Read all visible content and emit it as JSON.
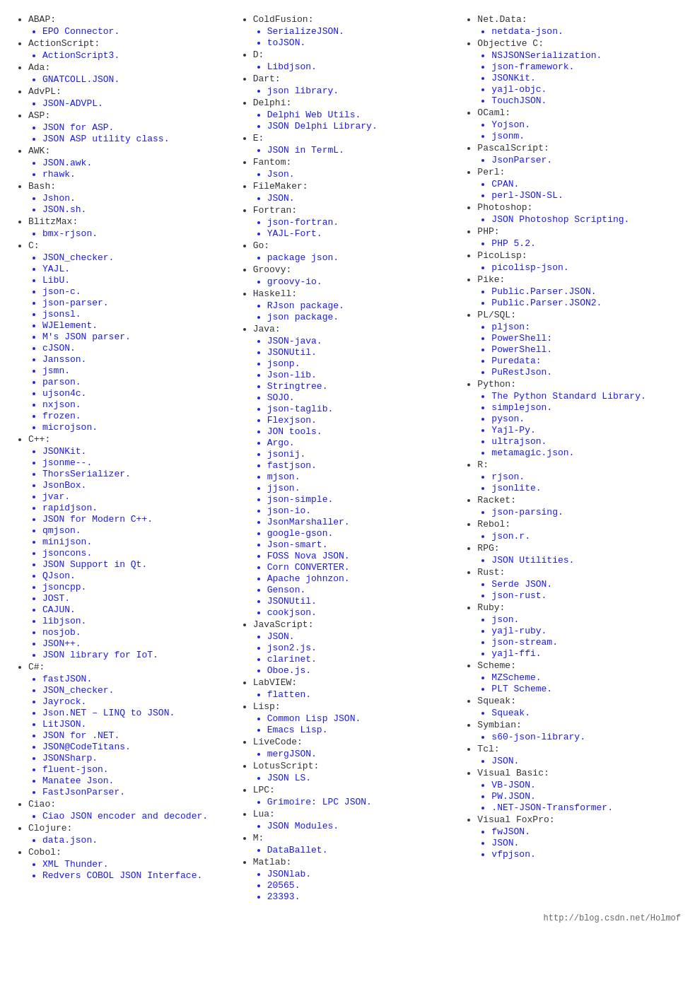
{
  "columns": [
    {
      "items": [
        {
          "lang": "ABAP:",
          "libs": [
            "EPO Connector."
          ]
        },
        {
          "lang": "ActionScript:",
          "libs": [
            "ActionScript3."
          ]
        },
        {
          "lang": "Ada:",
          "libs": [
            "GNATCOLL.JSON."
          ]
        },
        {
          "lang": "AdvPL:",
          "libs": [
            "JSON-ADVPL."
          ]
        },
        {
          "lang": "ASP:",
          "libs": [
            "JSON for ASP.",
            "JSON ASP utility class."
          ]
        },
        {
          "lang": "AWK:",
          "libs": [
            "JSON.awk.",
            "rhawk."
          ]
        },
        {
          "lang": "Bash:",
          "libs": [
            "Jshon.",
            "JSON.sh."
          ]
        },
        {
          "lang": "BlitzMax:",
          "libs": [
            "bmx-rjson."
          ]
        },
        {
          "lang": "C:",
          "libs": [
            "JSON_checker.",
            "YAJL.",
            "LibU.",
            "json-c.",
            "json-parser.",
            "jsonsl.",
            "WJElement.",
            "M's JSON parser.",
            "cJSON.",
            "Jansson.",
            "jsmn.",
            "parson.",
            "ujson4c.",
            "nxjson.",
            "frozen.",
            "microjson."
          ]
        },
        {
          "lang": "C++:",
          "libs": [
            "JSONKit.",
            "jsonme--.",
            "ThorsSerializer.",
            "JsonBox.",
            "jvar.",
            "rapidjson.",
            "JSON for Modern C++.",
            "qmjson.",
            "minijson.",
            "jsoncons.",
            "JSON Support in Qt.",
            "QJson.",
            "jsoncpp.",
            "JOST.",
            "CAJUN.",
            "libjson.",
            "nosjob.",
            "JSON++.",
            "JSON library for IoT."
          ]
        },
        {
          "lang": "C#:",
          "libs": [
            "fastJSON.",
            "JSON_checker.",
            "Jayrock.",
            "Json.NET – LINQ to JSON.",
            "LitJSON.",
            "JSON for .NET.",
            "JSON@CodeTitans.",
            "JSONSharp.",
            "fluent-json.",
            "Manatee Json.",
            "FastJsonParser."
          ]
        },
        {
          "lang": "Ciao:",
          "libs": [
            "Ciao JSON encoder and decoder."
          ]
        },
        {
          "lang": "Clojure:",
          "libs": [
            "data.json."
          ]
        },
        {
          "lang": "Cobol:",
          "libs": [
            "XML Thunder.",
            "Redvers COBOL JSON Interface."
          ]
        }
      ]
    },
    {
      "items": [
        {
          "lang": "ColdFusion:",
          "libs": [
            "SerializeJSON.",
            "toJSON."
          ]
        },
        {
          "lang": "D:",
          "libs": [
            "Libdjson."
          ]
        },
        {
          "lang": "Dart:",
          "libs": [
            "json library."
          ]
        },
        {
          "lang": "Delphi:",
          "libs": [
            "Delphi Web Utils.",
            "JSON Delphi Library."
          ]
        },
        {
          "lang": "E:",
          "libs": [
            "JSON in TermL."
          ]
        },
        {
          "lang": "Fantom:",
          "libs": [
            "Json."
          ]
        },
        {
          "lang": "FileMaker:",
          "libs": [
            "JSON."
          ]
        },
        {
          "lang": "Fortran:",
          "libs": [
            "json-fortran.",
            "YAJL-Fort."
          ]
        },
        {
          "lang": "Go:",
          "libs": [
            "package json."
          ]
        },
        {
          "lang": "Groovy:",
          "libs": [
            "groovy-io."
          ]
        },
        {
          "lang": "Haskell:",
          "libs": [
            "RJson package.",
            "json package."
          ]
        },
        {
          "lang": "Java:",
          "libs": [
            "JSON-java.",
            "JSONUtil.",
            "jsonp.",
            "Json-lib.",
            "Stringtree.",
            "SOJO.",
            "json-taglib.",
            "Flexjson.",
            "JON tools.",
            "Argo.",
            "jsonij.",
            "fastjson.",
            "mjson.",
            "jjson.",
            "json-simple.",
            "json-io.",
            "JsonMarshaller.",
            "google-gson.",
            "Json-smart.",
            "FOSS Nova JSON.",
            "Corn CONVERTER.",
            "Apache johnzon.",
            "Genson.",
            "JSONUtil.",
            "cookjson."
          ]
        },
        {
          "lang": "JavaScript:",
          "libs": [
            "JSON.",
            "json2.js.",
            "clarinet.",
            "Oboe.js."
          ]
        },
        {
          "lang": "LabVIEW:",
          "libs": [
            "flatten."
          ]
        },
        {
          "lang": "Lisp:",
          "libs": [
            "Common Lisp JSON.",
            "Emacs Lisp."
          ]
        },
        {
          "lang": "LiveCode:",
          "libs": [
            "mergJSON."
          ]
        },
        {
          "lang": "LotusScript:",
          "libs": [
            "JSON LS."
          ]
        },
        {
          "lang": "LPC:",
          "libs": [
            "Grimoire: LPC JSON."
          ]
        },
        {
          "lang": "Lua:",
          "libs": [
            "JSON Modules."
          ]
        },
        {
          "lang": "M:",
          "libs": [
            "DataBallet."
          ]
        },
        {
          "lang": "Matlab:",
          "libs": [
            "JSONlab.",
            "20565.",
            "23393."
          ]
        }
      ]
    },
    {
      "items": [
        {
          "lang": "Net.Data:",
          "libs": [
            "netdata-json."
          ]
        },
        {
          "lang": "Objective C:",
          "libs": [
            "NSJSONSerialization.",
            "json-framework.",
            "JSONKit.",
            "yajl-objc.",
            "TouchJSON."
          ]
        },
        {
          "lang": "OCaml:",
          "libs": [
            "Yojson.",
            "jsonm."
          ]
        },
        {
          "lang": "PascalScript:",
          "libs": [
            "JsonParser."
          ]
        },
        {
          "lang": "Perl:",
          "libs": [
            "CPAN.",
            "perl-JSON-SL."
          ]
        },
        {
          "lang": "Photoshop:",
          "libs": [
            "JSON Photoshop Scripting."
          ]
        },
        {
          "lang": "PHP:",
          "libs": [
            "PHP 5.2."
          ]
        },
        {
          "lang": "PicoLisp:",
          "libs": [
            "picolisp-json."
          ]
        },
        {
          "lang": "Pike:",
          "libs": [
            "Public.Parser.JSON.",
            "Public.Parser.JSON2."
          ]
        },
        {
          "lang": "PL/SQL:",
          "libs": [
            "pljson:",
            "PowerShell:",
            "PowerShell.",
            "Puredata:",
            "PuRestJson."
          ]
        },
        {
          "lang": "Python:",
          "libs": [
            "The Python Standard Library.",
            "simplejson.",
            "pyson.",
            "Yajl-Py.",
            "ultrajson.",
            "metamagic.json."
          ]
        },
        {
          "lang": "R:",
          "libs": [
            "rjson.",
            "jsonlite."
          ]
        },
        {
          "lang": "Racket:",
          "libs": [
            "json-parsing."
          ]
        },
        {
          "lang": "Rebol:",
          "libs": [
            "json.r."
          ]
        },
        {
          "lang": "RPG:",
          "libs": [
            "JSON Utilities."
          ]
        },
        {
          "lang": "Rust:",
          "libs": [
            "Serde JSON.",
            "json-rust."
          ]
        },
        {
          "lang": "Ruby:",
          "libs": [
            "json.",
            "yajl-ruby.",
            "json-stream.",
            "yajl-ffi."
          ]
        },
        {
          "lang": "Scheme:",
          "libs": [
            "MZScheme.",
            "PLT Scheme."
          ]
        },
        {
          "lang": "Squeak:",
          "libs": [
            "Squeak."
          ]
        },
        {
          "lang": "Symbian:",
          "libs": [
            "s60-json-library."
          ]
        },
        {
          "lang": "Tcl:",
          "libs": [
            "JSON."
          ]
        },
        {
          "lang": "Visual Basic:",
          "libs": [
            "VB-JSON.",
            "PW.JSON.",
            ".NET-JSON-Transformer."
          ]
        },
        {
          "lang": "Visual FoxPro:",
          "libs": [
            "fwJSON.",
            "JSON.",
            "vfpjson."
          ]
        }
      ]
    }
  ],
  "footer": "http://blog.csdn.net/Holmof"
}
